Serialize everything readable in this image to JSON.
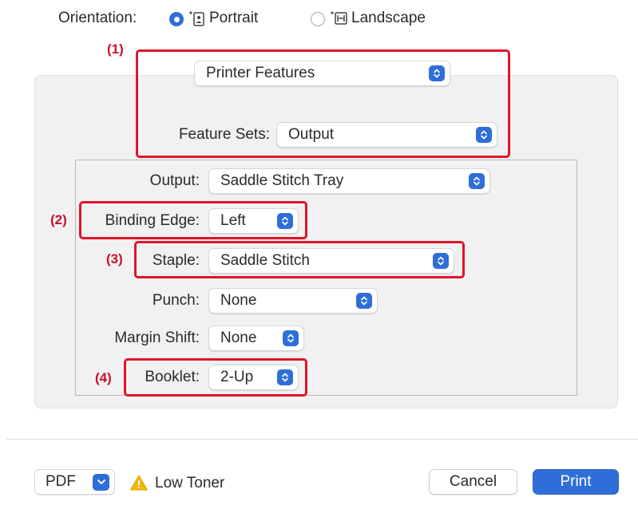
{
  "orientation": {
    "label": "Orientation:",
    "portrait_label": "Portrait",
    "landscape_label": "Landscape",
    "selected": "Portrait"
  },
  "annotations": {
    "m1": "(1)",
    "m2": "(2)",
    "m3": "(3)",
    "m4": "(4)"
  },
  "header_popup": {
    "value": "Printer Features"
  },
  "feature_sets": {
    "label": "Feature Sets:",
    "value": "Output"
  },
  "settings": {
    "output": {
      "label": "Output:",
      "value": "Saddle Stitch Tray"
    },
    "binding": {
      "label": "Binding Edge:",
      "value": "Left"
    },
    "staple": {
      "label": "Staple:",
      "value": "Saddle Stitch"
    },
    "punch": {
      "label": "Punch:",
      "value": "None"
    },
    "margin": {
      "label": "Margin Shift:",
      "value": "None"
    },
    "booklet": {
      "label": "Booklet:",
      "value": "2-Up"
    }
  },
  "footer": {
    "pdf_label": "PDF",
    "status_text": "Low Toner",
    "cancel_label": "Cancel",
    "print_label": "Print"
  },
  "colors": {
    "accent": "#2f6ed8",
    "annotation_red": "#e0142a",
    "warning": "#f2b705"
  },
  "icons": [
    "portrait-orientation-icon",
    "landscape-orientation-icon",
    "stepper-arrows-icon",
    "chevron-down-icon",
    "warning-icon"
  ]
}
